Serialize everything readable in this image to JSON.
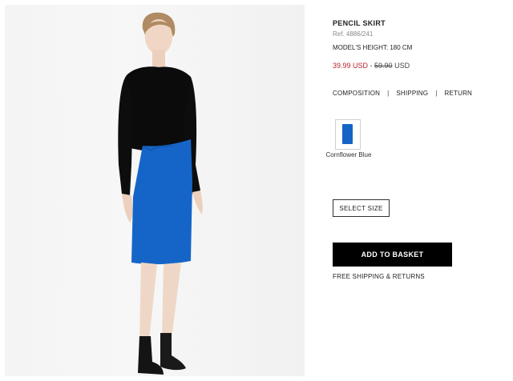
{
  "product": {
    "title": "PENCIL SKIRT",
    "ref": "Ref. 4886/241",
    "model_height": "MODEL'S HEIGHT: 180 CM",
    "sale_price": "39.99 USD",
    "price_separator": " - ",
    "old_price": "59.90",
    "old_price_currency": " USD"
  },
  "info_links": [
    {
      "label": "COMPOSITION"
    },
    {
      "label": "SHIPPING"
    },
    {
      "label": "RETURN"
    }
  ],
  "link_separator": "|",
  "colors": {
    "selected_name": "Cornflower Blue",
    "swatch_hex": "#1563c5"
  },
  "actions": {
    "select_size": "SELECT SIZE",
    "add_to_basket": "ADD TO BASKET",
    "free_shipping": "FREE SHIPPING & RETURNS"
  },
  "photo": {
    "icon": "model-photo",
    "top_color": "#0a0a0a",
    "skirt_color": "#1565c8"
  }
}
